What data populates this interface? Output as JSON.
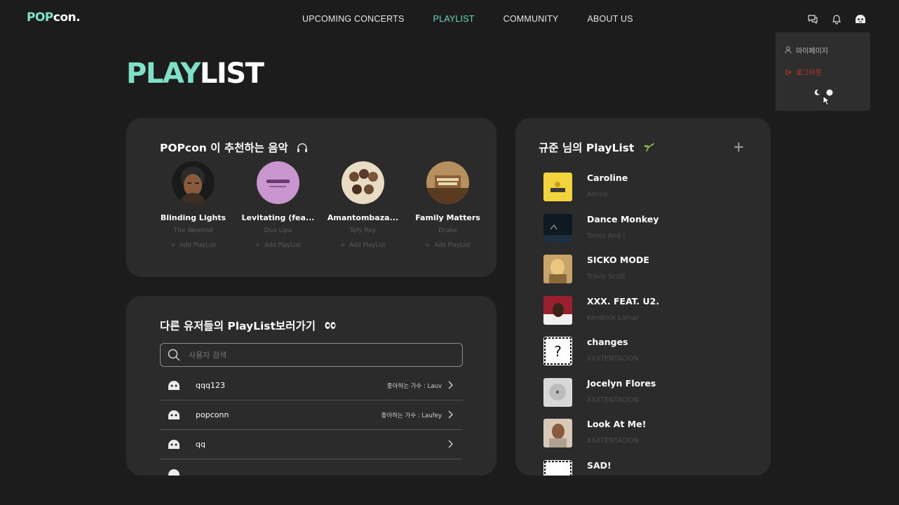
{
  "brand": {
    "pop": "POP",
    "con": "con."
  },
  "nav": {
    "links": [
      "UPCOMING CONCERTS",
      "PLAYLIST",
      "COMMUNITY",
      "ABOUT US"
    ],
    "active": "PLAYLIST",
    "icons": [
      "chat-icon",
      "bell-icon",
      "user-avatar-icon"
    ]
  },
  "dropdown": {
    "mypage": "마이페이지",
    "logout": "로그아웃"
  },
  "page": {
    "title_play": "PLAY",
    "title_list": "LIST"
  },
  "recommend": {
    "heading": "POPcon 이 추천하는 음악",
    "add_label": "Add PlayList",
    "items": [
      {
        "title": "Blinding Lights",
        "artist": "The Weeknd",
        "add": "Add PlayList"
      },
      {
        "title": "Levitating (fea...",
        "artist": "Dua Lipa",
        "add": "Add PlayList"
      },
      {
        "title": "Amantombaza...",
        "artist": "Tefy Rey",
        "add": "Add PlayList"
      },
      {
        "title": "Family Matters",
        "artist": "Drake",
        "add": "Add PlayList"
      }
    ]
  },
  "others": {
    "heading": "다른 유저들의 PlayList보러가기",
    "search_placeholder": "사용자 검색",
    "users": [
      {
        "name": "qqq123",
        "fav": "좋아하는 가수 : Lauv"
      },
      {
        "name": "popconn",
        "fav": "좋아하는 가수 : Laufey"
      },
      {
        "name": "qq",
        "fav": ""
      },
      {
        "name": "",
        "fav": ""
      }
    ]
  },
  "mylist": {
    "heading": "규준 님의 PlayList",
    "add_symbol": "+",
    "songs": [
      {
        "title": "Caroline",
        "artist": "Aminé"
      },
      {
        "title": "Dance Monkey",
        "artist": "Tones And I"
      },
      {
        "title": "SICKO MODE",
        "artist": "Travis Scott"
      },
      {
        "title": "XXX. FEAT. U2.",
        "artist": "Kendrick Lamar"
      },
      {
        "title": "changes",
        "artist": "XXXTENTACION"
      },
      {
        "title": "Jocelyn Flores",
        "artist": "XXXTENTACION"
      },
      {
        "title": "Look At Me!",
        "artist": "XXXTENTACION"
      },
      {
        "title": "SAD!",
        "artist": ""
      }
    ]
  },
  "colors": {
    "accent": "#7fe0c8",
    "background": "#1c1c1c",
    "card": "#2b2b2b",
    "logout": "#c0392b"
  }
}
